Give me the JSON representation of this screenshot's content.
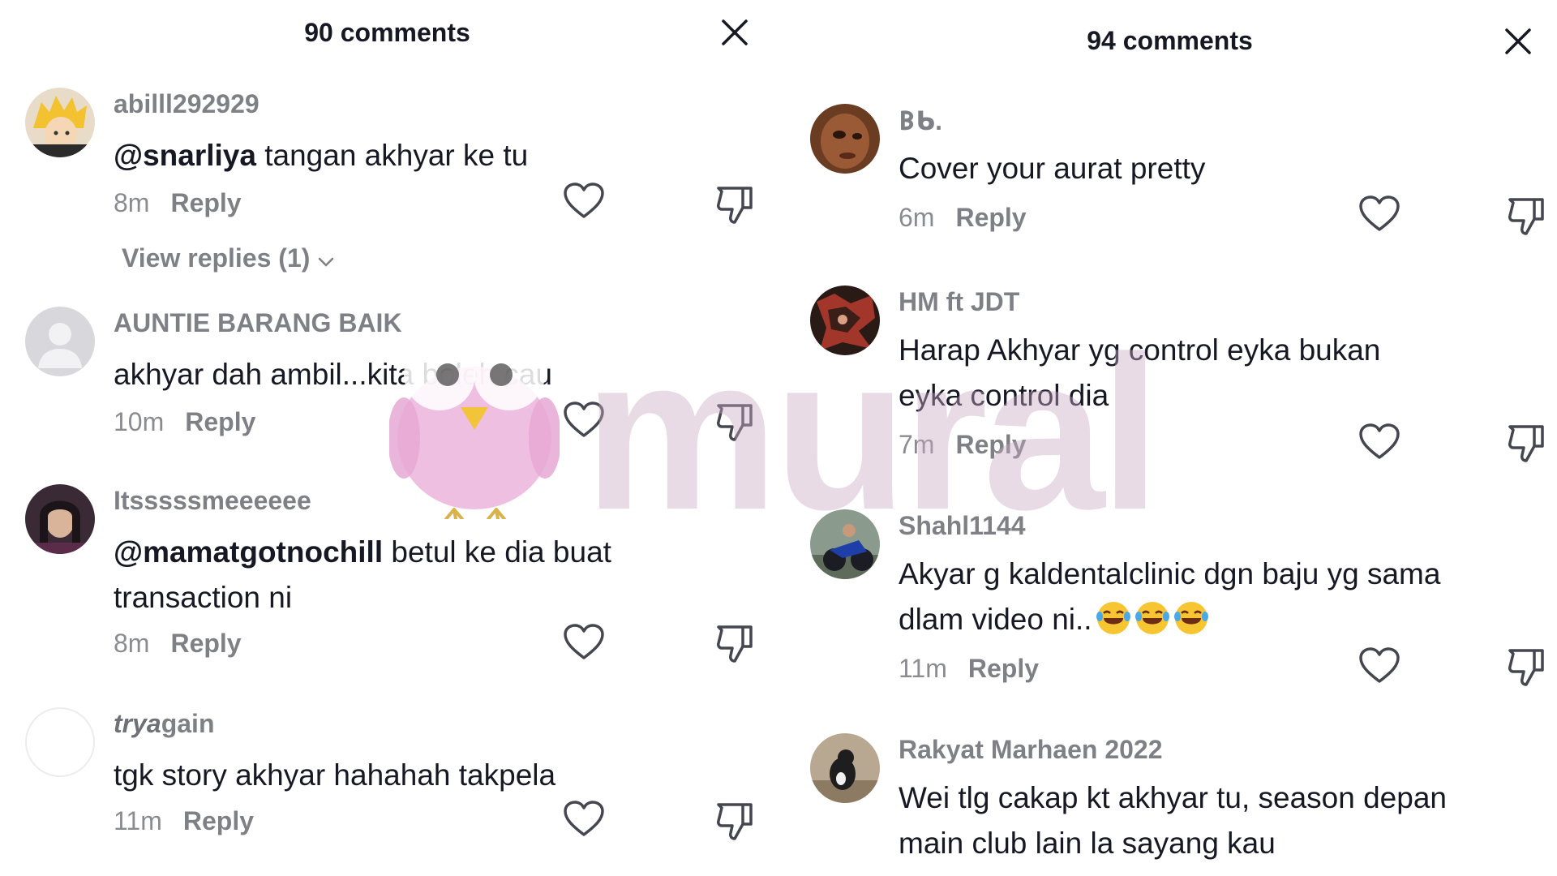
{
  "left": {
    "title": "90 comments",
    "comments": [
      {
        "username": "abilll292929",
        "mention": "@snarliya",
        "text": " tangan akhyar ke tu",
        "time": "8m",
        "reply": "Reply",
        "view_replies": "View replies (1)"
      },
      {
        "username": "AUNTIE BARANG BAIK",
        "mention": "",
        "text": "akhyar dah ambil...kita boleh cau",
        "time": "10m",
        "reply": "Reply"
      },
      {
        "username": "Itsssssmeeeeee",
        "mention": "@mamatgotnochill",
        "text": " betul ke dia buat transaction ni",
        "time": "8m",
        "reply": "Reply"
      },
      {
        "username_bold": "trya",
        "username_rest": "gain",
        "mention": "",
        "text": "tgk story akhyar hahahah takpela",
        "time": "11m",
        "reply": "Reply"
      }
    ]
  },
  "right": {
    "title": "94 comments",
    "comments": [
      {
        "username": "𐌁ᑲ.",
        "text": "Cover your aurat pretty",
        "time": "6m",
        "reply": "Reply"
      },
      {
        "username": "HM ft JDT",
        "text": "Harap Akhyar yg control eyka bukan eyka control dia",
        "time": "7m",
        "reply": "Reply"
      },
      {
        "username": "Shahl1144",
        "text": "Akyar g kaldentalclinic dgn baju yg sama dlam video ni..",
        "emoji": "laughing-tears",
        "time": "11m",
        "reply": "Reply"
      },
      {
        "username": "Rakyat Marhaen 2022",
        "text": "Wei tlg cakap kt akhyar tu, season depan main club lain la sayang kau"
      }
    ]
  },
  "watermark": "mural",
  "colors": {
    "text": "#161823",
    "muted": "rgba(22,24,35,0.55)",
    "watermark": "#c8aac3"
  }
}
